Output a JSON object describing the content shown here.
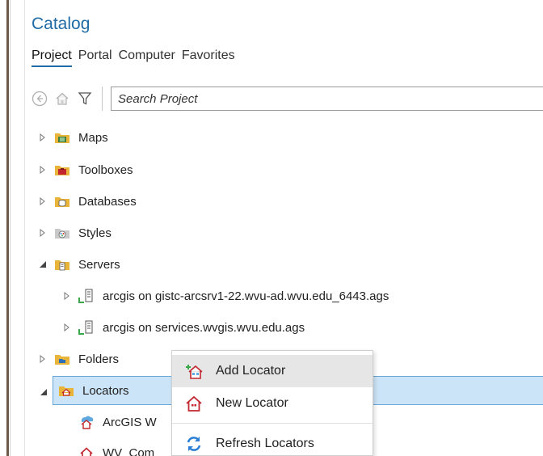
{
  "pane": {
    "title": "Catalog"
  },
  "tabs": [
    {
      "label": "Project",
      "active": true
    },
    {
      "label": "Portal",
      "active": false
    },
    {
      "label": "Computer",
      "active": false
    },
    {
      "label": "Favorites",
      "active": false
    }
  ],
  "toolbar": {
    "search_placeholder": "Search Project"
  },
  "tree": {
    "maps": "Maps",
    "toolboxes": "Toolboxes",
    "databases": "Databases",
    "styles": "Styles",
    "servers": "Servers",
    "server1": "arcgis on gistc-arcsrv1-22.wvu-ad.wvu.edu_6443.ags",
    "server2": "arcgis on services.wvgis.wvu.edu.ags",
    "folders": "Folders",
    "locators": "Locators",
    "locator1": "ArcGIS W",
    "locator2": "WV_Com"
  },
  "context_menu": {
    "add_locator": "Add Locator",
    "new_locator": "New Locator",
    "refresh_locators": "Refresh Locators"
  },
  "colors": {
    "accent": "#1f6ba5",
    "selection": "#cce4f7",
    "folder": "#e8b53a"
  }
}
